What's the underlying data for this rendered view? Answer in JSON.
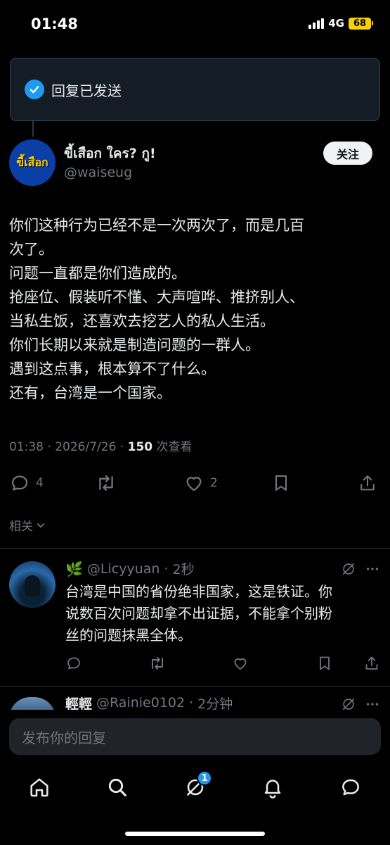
{
  "status_bar": {
    "time": "01:48",
    "network": "4G",
    "battery": "68"
  },
  "toast": {
    "text": "回复已发送"
  },
  "tweet": {
    "author_name": "ขี้เสือก ใคร? กู!",
    "author_handle": "@waiseug",
    "avatar_text": "ขี้เสือก",
    "follow_label": "关注",
    "lines": [
      "你们这种行为已经不是一次两次了，而是几百",
      "次了。",
      "问题一直都是你们造成的。",
      "抢座位、假装听不懂、大声喧哗、推挤别人、",
      "当私生饭，还喜欢去挖艺人的私人生活。",
      "你们长期以来就是制造问题的一群人。",
      "遇到这点事，根本算不了什么。",
      "还有，台湾是一个国家。"
    ],
    "time": "01:38",
    "date": "2026/7/26",
    "views_count": "150",
    "views_label": "次查看",
    "reply_count": "4",
    "like_count": "2"
  },
  "related_label": "相关",
  "replies": [
    {
      "emoji": "🌿",
      "handle": "@Licyyuan",
      "time": "2秒",
      "lines": [
        "台湾是中国的省份绝非国家，这是铁证。你",
        "说数百次问题却拿不出证据，不能拿个别粉",
        "丝的问题抹黑全体。"
      ]
    },
    {
      "name": "輕輕",
      "handle": "@Rainie0102",
      "time": "2分钟"
    }
  ],
  "compose": {
    "placeholder": "发布你的回复"
  },
  "tabbar": {
    "items": [
      "home-icon",
      "search-icon",
      "grok-icon",
      "bell-icon",
      "messages-icon"
    ],
    "badge": "1"
  },
  "colors": {
    "background": "#000000",
    "accent": "#1d9bf0",
    "muted": "#71767b",
    "text": "#e7e9ea",
    "battery": "#f5d10a"
  }
}
